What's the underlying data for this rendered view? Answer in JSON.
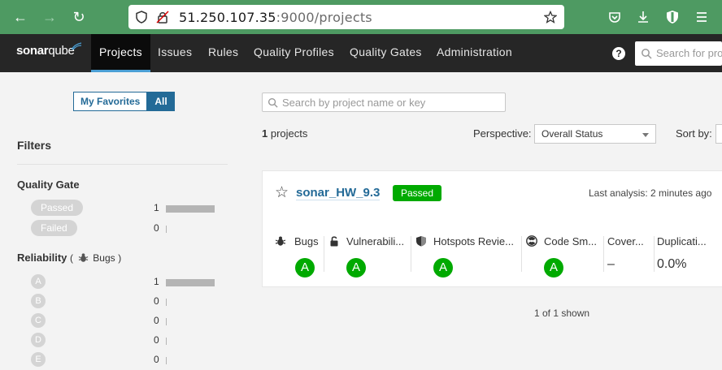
{
  "browser": {
    "url_host": "51.250.107.35",
    "url_rest": ":9000/projects"
  },
  "header": {
    "logo_sonar": "sonar",
    "logo_qube": "qube",
    "nav": [
      "Projects",
      "Issues",
      "Rules",
      "Quality Profiles",
      "Quality Gates",
      "Administration"
    ],
    "active_nav": "Projects",
    "search_placeholder": "Search for pro"
  },
  "sidebar": {
    "toggle": {
      "favorites": "My Favorites",
      "all": "All",
      "selected": "All"
    },
    "filters_title": "Filters",
    "quality_gate": {
      "title": "Quality Gate",
      "options": [
        {
          "label": "Passed",
          "count": "1",
          "fraction": 1
        },
        {
          "label": "Failed",
          "count": "0",
          "fraction": 0
        }
      ]
    },
    "reliability": {
      "title": "Reliability",
      "sub_open": "(",
      "sub_label": "Bugs",
      "sub_close": ")",
      "options": [
        {
          "label": "A",
          "count": "1",
          "fraction": 1
        },
        {
          "label": "B",
          "count": "0",
          "fraction": 0
        },
        {
          "label": "C",
          "count": "0",
          "fraction": 0
        },
        {
          "label": "D",
          "count": "0",
          "fraction": 0
        },
        {
          "label": "E",
          "count": "0",
          "fraction": 0
        }
      ]
    }
  },
  "main": {
    "search_placeholder": "Search by project name or key",
    "project_count_num": "1",
    "project_count_text": "projects",
    "perspective_label": "Perspective:",
    "perspective_value": "Overall Status",
    "sort_label": "Sort by:",
    "project": {
      "name": "sonar_HW_9.3",
      "status": "Passed",
      "last_analysis": "Last analysis: 2 minutes ago",
      "measures": [
        {
          "label": "Bugs",
          "icon": "bug-icon",
          "rating": "A"
        },
        {
          "label": "Vulnerabili...",
          "icon": "lock-icon",
          "rating": "A"
        },
        {
          "label": "Hotspots Revie...",
          "icon": "shield-icon",
          "rating": "A"
        },
        {
          "label": "Code Sm...",
          "icon": "radiation-icon",
          "rating": "A"
        },
        {
          "label": "Cover...",
          "value": "–"
        },
        {
          "label": "Duplicati...",
          "value": "0.0%"
        }
      ]
    },
    "shown_text": "1 of 1 shown"
  },
  "colors": {
    "browser_green": "#4e9a62",
    "header_bg": "#262626",
    "accent_blue": "#236a97",
    "passed_green": "#00aa00",
    "disabled_gray": "#d4d4d4"
  }
}
